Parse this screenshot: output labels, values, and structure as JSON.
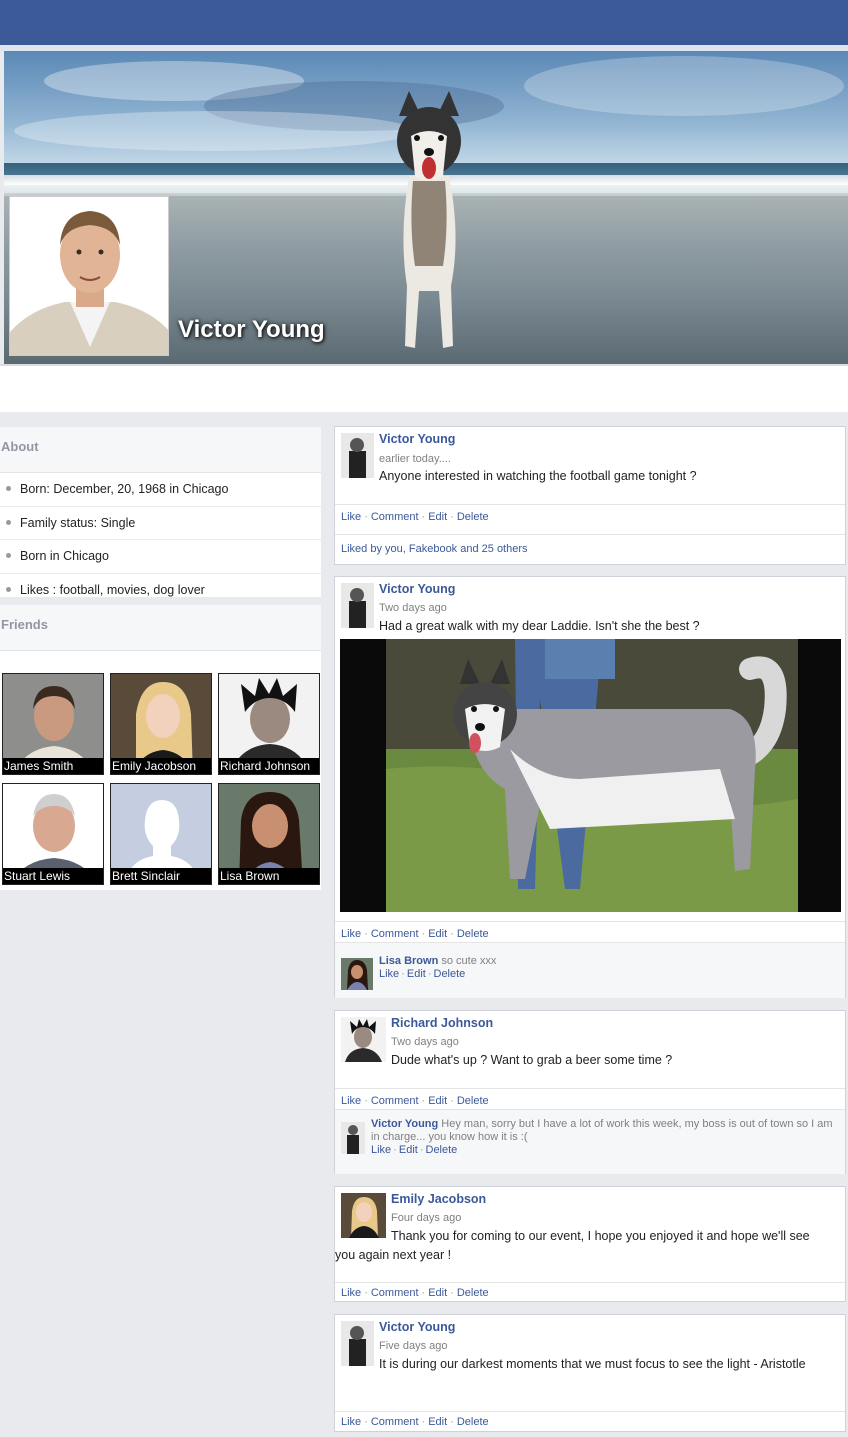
{
  "profile": {
    "name": "Victor Young"
  },
  "about": {
    "title": "About",
    "items": [
      "Born: December, 20, 1968 in Chicago",
      "Family status: Single",
      "Born in Chicago",
      "Likes : football, movies, dog lover"
    ]
  },
  "friends": {
    "title": "Friends",
    "list": [
      "James Smith",
      "Emily Jacobson",
      "Richard Johnson",
      "Stuart Lewis",
      "Brett Sinclair",
      "Lisa Brown"
    ]
  },
  "actions": {
    "like": "Like",
    "comment": "Comment",
    "edit": "Edit",
    "delete": "Delete",
    "sep": "·"
  },
  "posts": [
    {
      "author": "Victor Young",
      "time": "earlier today....",
      "text": "Anyone interested in watching the football game tonight ?",
      "liked_by": "Liked by you, Fakebook and 25 others"
    },
    {
      "author": "Victor Young",
      "time": "Two days ago",
      "text": "Had a great walk with my dear Laddie. Isn't she the best ?",
      "comment": {
        "author": "Lisa Brown",
        "text": "so cute xxx"
      }
    },
    {
      "author": "Richard Johnson",
      "time": "Two days ago",
      "text": "Dude what's up ? Want to grab a beer some time ?",
      "comment": {
        "author": "Victor Young",
        "text": "Hey man, sorry but I have a lot of work this week, my boss is out of town so I am in charge... you know how it is :("
      }
    },
    {
      "author": "Emily Jacobson",
      "time": "Four days ago",
      "text_line1": "Thank you for coming to our event, I hope you enjoyed it and hope we'll see",
      "text_line2": "you again next year !"
    },
    {
      "author": "Victor Young",
      "time": "Five days ago",
      "text": "It is during our darkest moments that we must focus to see the light - Aristotle"
    }
  ]
}
